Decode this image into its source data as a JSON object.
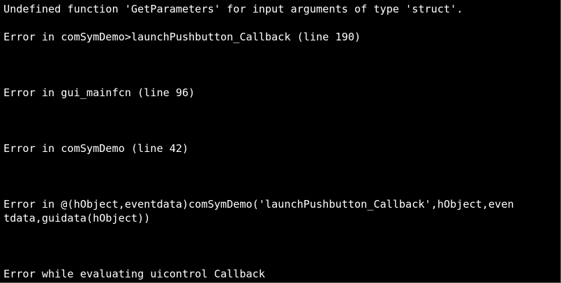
{
  "console": {
    "lines": [
      "Undefined function 'GetParameters' for input arguments of type 'struct'.",
      "Error in comSymDemo>launchPushbutton_Callback (line 190)",
      "Error in gui_mainfcn (line 96)",
      "Error in comSymDemo (line 42)",
      "Error in @(hObject,eventdata)comSymDemo('launchPushbutton_Callback',hObject,even",
      "tdata,guidata(hObject))",
      "Error while evaluating uicontrol Callback"
    ]
  },
  "colors": {
    "background": "#000000",
    "text": "#ffffff"
  }
}
